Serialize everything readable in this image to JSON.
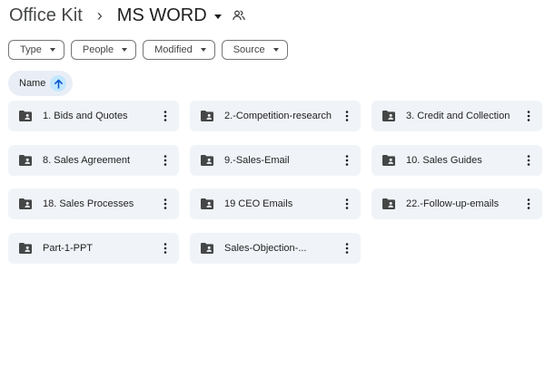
{
  "breadcrumb": {
    "root": "Office Kit",
    "separator": "›",
    "current": "MS WORD"
  },
  "icons": {
    "folder": "shared-folder-icon",
    "more": "more-vert-icon",
    "shared": "people-icon",
    "sort": "arrow-upward-icon"
  },
  "colors": {
    "card_bg": "#f0f4f9",
    "sort_chip_bg": "#e9eef6",
    "sort_arrow_bg": "#c2e7ff",
    "icon": "#444746"
  },
  "filters": [
    {
      "label": "Type"
    },
    {
      "label": "People"
    },
    {
      "label": "Modified"
    },
    {
      "label": "Source"
    }
  ],
  "sort": {
    "label": "Name",
    "direction": "ascending"
  },
  "folders": [
    {
      "name": "1. Bids and Quotes"
    },
    {
      "name": "2.-Competition-research"
    },
    {
      "name": "3. Credit and Collection"
    },
    {
      "name": "8. Sales Agreement"
    },
    {
      "name": "9.-Sales-Email"
    },
    {
      "name": "10. Sales Guides"
    },
    {
      "name": "18. Sales Processes"
    },
    {
      "name": "19 CEO Emails"
    },
    {
      "name": "22.-Follow-up-emails"
    },
    {
      "name": "Part-1-PPT"
    },
    {
      "name": "Sales-Objection-..."
    }
  ]
}
